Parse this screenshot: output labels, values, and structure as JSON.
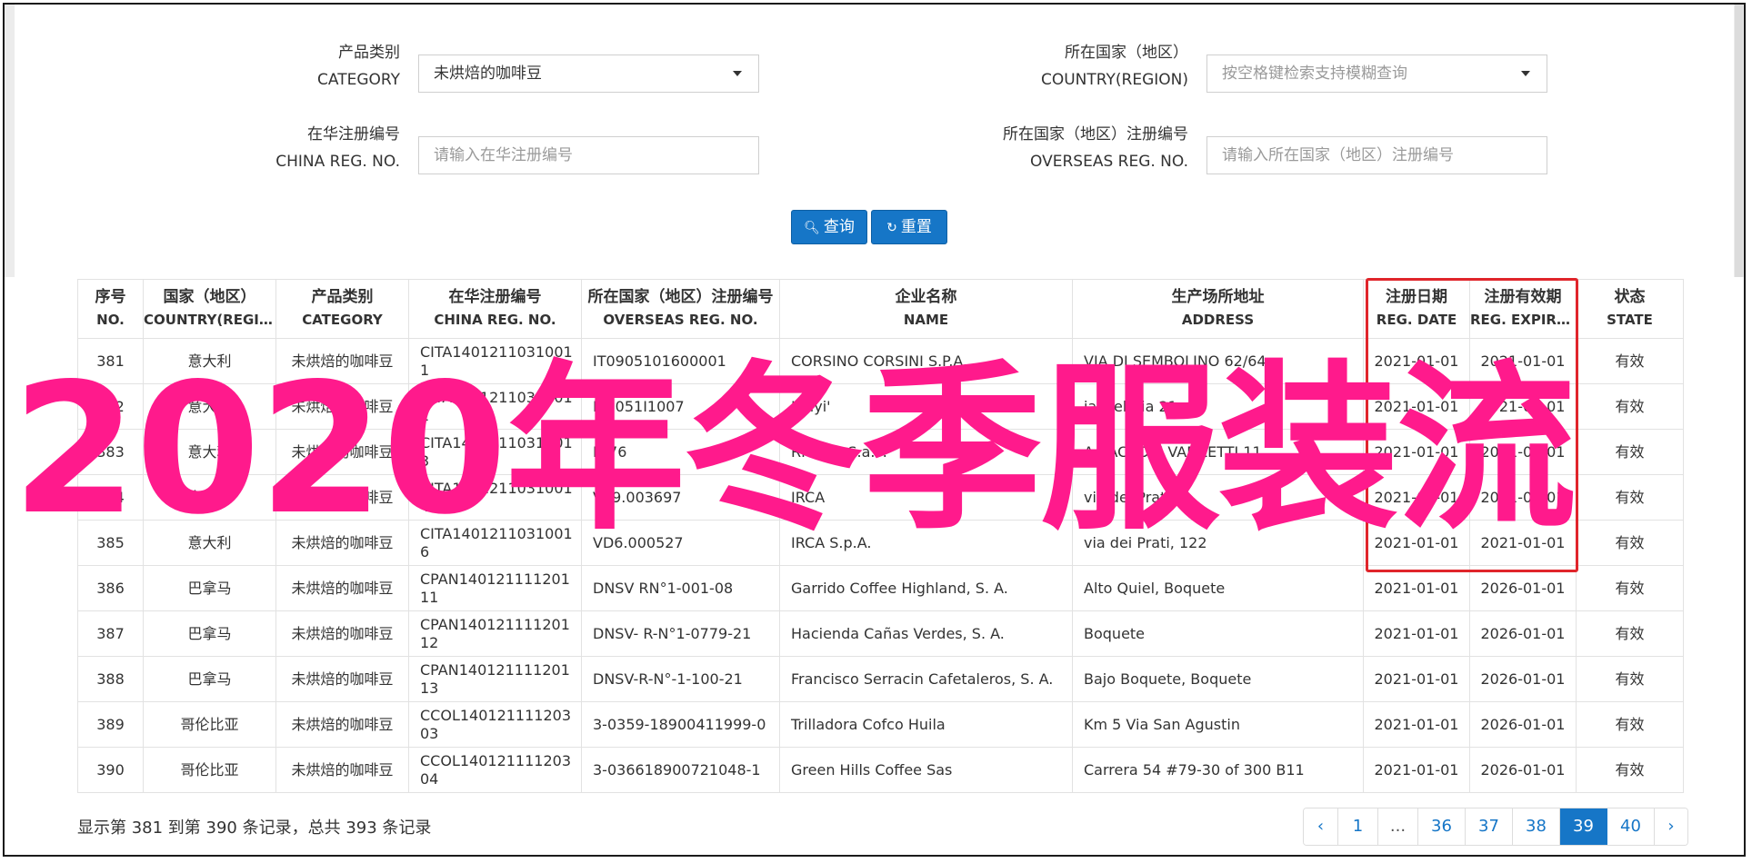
{
  "form": {
    "category": {
      "label_cn": "产品类别",
      "label_en": "CATEGORY",
      "value": "未烘焙的咖啡豆"
    },
    "country": {
      "label_cn": "所在国家（地区）",
      "label_en": "COUNTRY(REGION)",
      "placeholder": "按空格键检索支持模糊查询"
    },
    "china_reg": {
      "label_cn": "在华注册编号",
      "label_en": "CHINA REG. NO.",
      "placeholder": "请输入在华注册编号"
    },
    "overseas_reg": {
      "label_cn": "所在国家（地区）注册编号",
      "label_en": "OVERSEAS REG. NO.",
      "placeholder": "请输入所在国家（地区）注册编号"
    },
    "search_label": "查询",
    "reset_label": "重置"
  },
  "table": {
    "headers": [
      {
        "cn": "序号",
        "en": "NO."
      },
      {
        "cn": "国家（地区）",
        "en": "COUNTRY(REGIO..."
      },
      {
        "cn": "产品类别",
        "en": "CATEGORY"
      },
      {
        "cn": "在华注册编号",
        "en": "CHINA REG. NO."
      },
      {
        "cn": "所在国家（地区）注册编号",
        "en": "OVERSEAS REG. NO."
      },
      {
        "cn": "企业名称",
        "en": "NAME"
      },
      {
        "cn": "生产场所地址",
        "en": "ADDRESS"
      },
      {
        "cn": "注册日期",
        "en": "REG. DATE"
      },
      {
        "cn": "注册有效期",
        "en": "REG. EXPIRE ..."
      },
      {
        "cn": "状态",
        "en": "STATE"
      }
    ],
    "rows": [
      {
        "no": "381",
        "country": "意大利",
        "category": "未烘焙的咖啡豆",
        "china_reg": "CITA14012110310011",
        "overseas_reg": "IT0905101600001",
        "name": "CORSINO CORSINI S.P.A.",
        "address": "VIA DI SEMBOLINO 62/64",
        "reg_date": "2021-01-01",
        "expire": "2021-01-01",
        "state": "有效"
      },
      {
        "no": "382",
        "country": "意大利",
        "category": "未烘焙的咖啡豆",
        "china_reg": "CITA14012110310012",
        "overseas_reg": "IT2051I1007",
        "name": "Italyi'",
        "address": "ia Trebbia 21",
        "reg_date": "2021-01-01",
        "expire": "2021-01-01",
        "state": "有效"
      },
      {
        "no": "383",
        "country": "意大利",
        "category": "未烘焙的咖啡豆",
        "china_reg": "CITA14012110310013",
        "overseas_reg": "N 76",
        "name": "RMCKA S.a.s.",
        "address": "A SACCO E VANZETTI 11",
        "reg_date": "2021-01-01",
        "expire": "2021-01-01",
        "state": "有效"
      },
      {
        "no": "384",
        "country": "意大利",
        "category": "未烘焙的咖啡豆",
        "china_reg": "CITA14012110310014",
        "overseas_reg": "V69.003697",
        "name": "IRCA",
        "address": "via dei Prati, 5",
        "reg_date": "2021-01-01",
        "expire": "2021-01-01",
        "state": "有效"
      },
      {
        "no": "385",
        "country": "意大利",
        "category": "未烘焙的咖啡豆",
        "china_reg": "CITA14012110310016",
        "overseas_reg": "VD6.000527",
        "name": "IRCA S.p.A.",
        "address": "via dei Prati, 122",
        "reg_date": "2021-01-01",
        "expire": "2021-01-01",
        "state": "有效"
      },
      {
        "no": "386",
        "country": "巴拿马",
        "category": "未烘焙的咖啡豆",
        "china_reg": "CPAN14012111120111",
        "overseas_reg": "DNSV RN°1-001-08",
        "name": "Garrido Coffee Highland, S. A.",
        "address": "Alto Quiel, Boquete",
        "reg_date": "2021-01-01",
        "expire": "2026-01-01",
        "state": "有效"
      },
      {
        "no": "387",
        "country": "巴拿马",
        "category": "未烘焙的咖啡豆",
        "china_reg": "CPAN14012111120112",
        "overseas_reg": "DNSV- R-N°1-0779-21",
        "name": "Hacienda Cañas Verdes, S. A.",
        "address": "Boquete",
        "reg_date": "2021-01-01",
        "expire": "2026-01-01",
        "state": "有效"
      },
      {
        "no": "388",
        "country": "巴拿马",
        "category": "未烘焙的咖啡豆",
        "china_reg": "CPAN14012111120113",
        "overseas_reg": "DNSV-R-N°-1-100-21",
        "name": "Francisco Serracin Cafetaleros, S. A.",
        "address": "Bajo Boquete, Boquete",
        "reg_date": "2021-01-01",
        "expire": "2026-01-01",
        "state": "有效"
      },
      {
        "no": "389",
        "country": "哥伦比亚",
        "category": "未烘焙的咖啡豆",
        "china_reg": "CCOL14012111120303",
        "overseas_reg": "3-0359-18900411999-0",
        "name": "Trilladora Cofco Huila",
        "address": "Km 5 Via San Agustin",
        "reg_date": "2021-01-01",
        "expire": "2026-01-01",
        "state": "有效"
      },
      {
        "no": "390",
        "country": "哥伦比亚",
        "category": "未烘焙的咖啡豆",
        "china_reg": "CCOL14012111120304",
        "overseas_reg": "3-036618900721048-1",
        "name": "Green Hills Coffee Sas",
        "address": "Carrera 54 #79-30 of 300 B11",
        "reg_date": "2021-01-01",
        "expire": "2026-01-01",
        "state": "有效"
      }
    ]
  },
  "footer": {
    "info": "显示第 381 到第 390 条记录，总共 393 条记录"
  },
  "pagination": {
    "prev": "‹",
    "pages": [
      "1",
      "...",
      "36",
      "37",
      "38",
      "39",
      "40"
    ],
    "active": "39",
    "next": "›"
  },
  "watermark": "2020年冬季服装流",
  "colors": {
    "accent": "#1676c7",
    "highlight": "#e0252b",
    "watermark": "#ff1a8c"
  }
}
